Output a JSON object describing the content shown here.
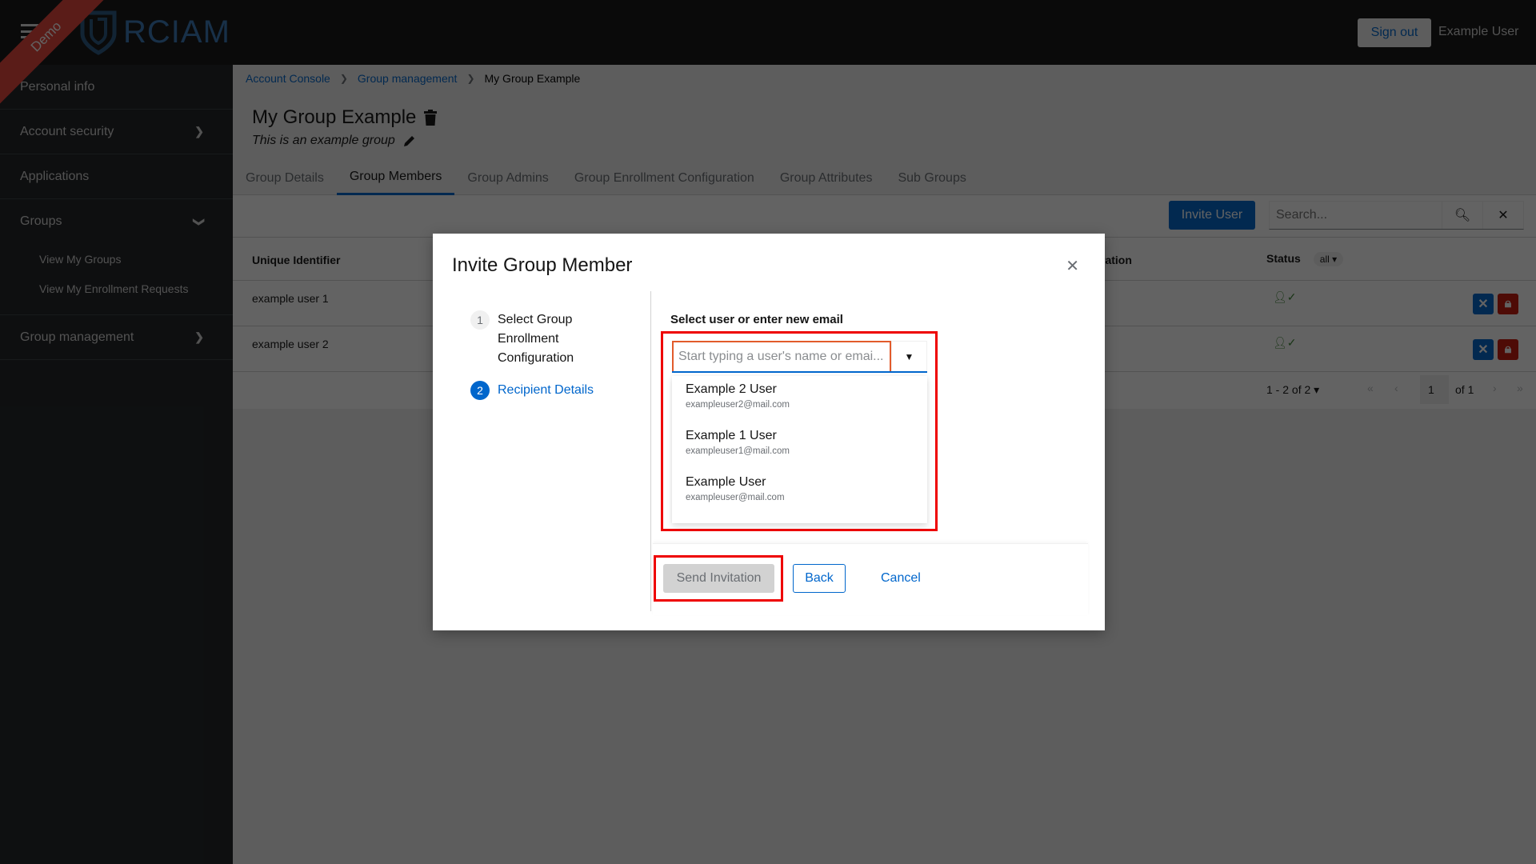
{
  "header": {
    "ribbon": "Demo",
    "logo_text": "RCIAM",
    "sign_out": "Sign out",
    "user_name": "Example User"
  },
  "sidebar": {
    "items": [
      {
        "label": "Personal info"
      },
      {
        "label": "Account security"
      },
      {
        "label": "Applications"
      },
      {
        "label": "Groups"
      },
      {
        "label": "Group management"
      }
    ],
    "groups_sub": [
      "View My Groups",
      "View My Enrollment Requests"
    ]
  },
  "breadcrumb": [
    "Account Console",
    "Group management",
    "My Group Example"
  ],
  "page": {
    "title": "My Group Example",
    "description": "This is an example group"
  },
  "tabs": [
    "Group Details",
    "Group Members",
    "Group Admins",
    "Group Enrollment Configuration",
    "Group Attributes",
    "Sub Groups"
  ],
  "toolbar": {
    "invite_user": "Invite User",
    "search_placeholder": "Search..."
  },
  "table": {
    "headers": {
      "id": "Unique Identifier",
      "hidden_col": "ration",
      "status": "Status",
      "status_filter": "all"
    },
    "rows": [
      {
        "id": "example user 1",
        "status": "active"
      },
      {
        "id": "example user 2",
        "status": "active"
      }
    ],
    "pagination": {
      "range": "1 - 2 of 2",
      "page": "1",
      "of": "of 1"
    }
  },
  "modal": {
    "title": "Invite Group Member",
    "steps": [
      {
        "num": "1",
        "label": "Select Group Enrollment Configuration"
      },
      {
        "num": "2",
        "label": "Recipient Details"
      }
    ],
    "field_label": "Select user or enter new email",
    "input_placeholder": "Start typing a user's name or emai...",
    "options": [
      {
        "name": "Example 2 User",
        "email": "exampleuser2@mail.com"
      },
      {
        "name": "Example 1 User",
        "email": "exampleuser1@mail.com"
      },
      {
        "name": "Example User",
        "email": "exampleuser@mail.com"
      }
    ],
    "send": "Send Invitation",
    "back": "Back",
    "cancel": "Cancel"
  }
}
